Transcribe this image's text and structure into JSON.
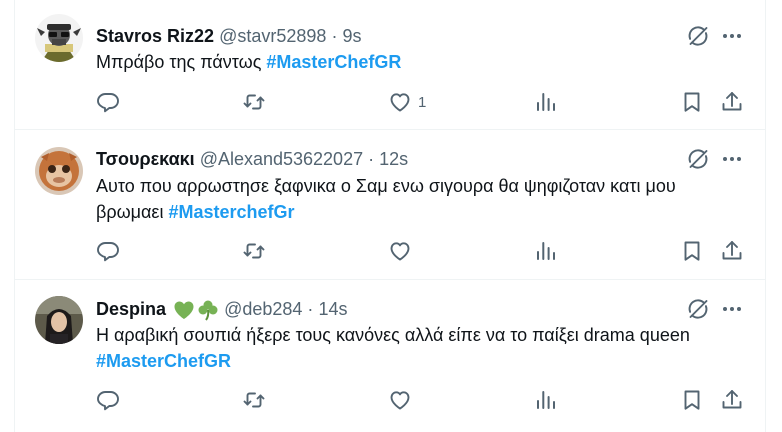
{
  "colors": {
    "hashtag": "#1d9bf0",
    "secondary": "#536471",
    "divider": "#eff3f4",
    "text": "#0f1419"
  },
  "tweets": [
    {
      "display_name": "Stavros Riz22",
      "handle": "@stavr52898",
      "separator": "·",
      "time": "9s",
      "text": "Μπράβο της πάντως ",
      "hashtag": "#MasterChefGR",
      "likes": "1",
      "icons": [
        "grok-icon",
        "more-icon",
        "reply-icon",
        "retweet-icon",
        "like-icon",
        "views-icon",
        "bookmark-icon",
        "share-icon"
      ]
    },
    {
      "display_name": "Τσουρεκακι",
      "handle": "@Alexand53622027",
      "separator": "·",
      "time": "12s",
      "text": "Αυτο που αρρωστησε ξαφνικα ο Σαμ ενω σιγουρα θα ψηφιζοταν κατι μου βρωμαει ",
      "hashtag": "#MasterchefGr",
      "likes": "",
      "icons": [
        "grok-icon",
        "more-icon",
        "reply-icon",
        "retweet-icon",
        "like-icon",
        "views-icon",
        "bookmark-icon",
        "share-icon"
      ]
    },
    {
      "display_name": "Despina",
      "name_emojis": [
        "green-heart-emoji",
        "shamrock-emoji"
      ],
      "handle": "@deb284",
      "separator": "·",
      "time": "14s",
      "text": "Η αραβική σουπιά ήξερε τους κανόνες αλλά είπε να το παίξει drama queen",
      "hashtag": "#MasterChefGR",
      "likes": "",
      "icons": [
        "grok-icon",
        "more-icon",
        "reply-icon",
        "retweet-icon",
        "like-icon",
        "views-icon",
        "bookmark-icon",
        "share-icon"
      ]
    }
  ]
}
